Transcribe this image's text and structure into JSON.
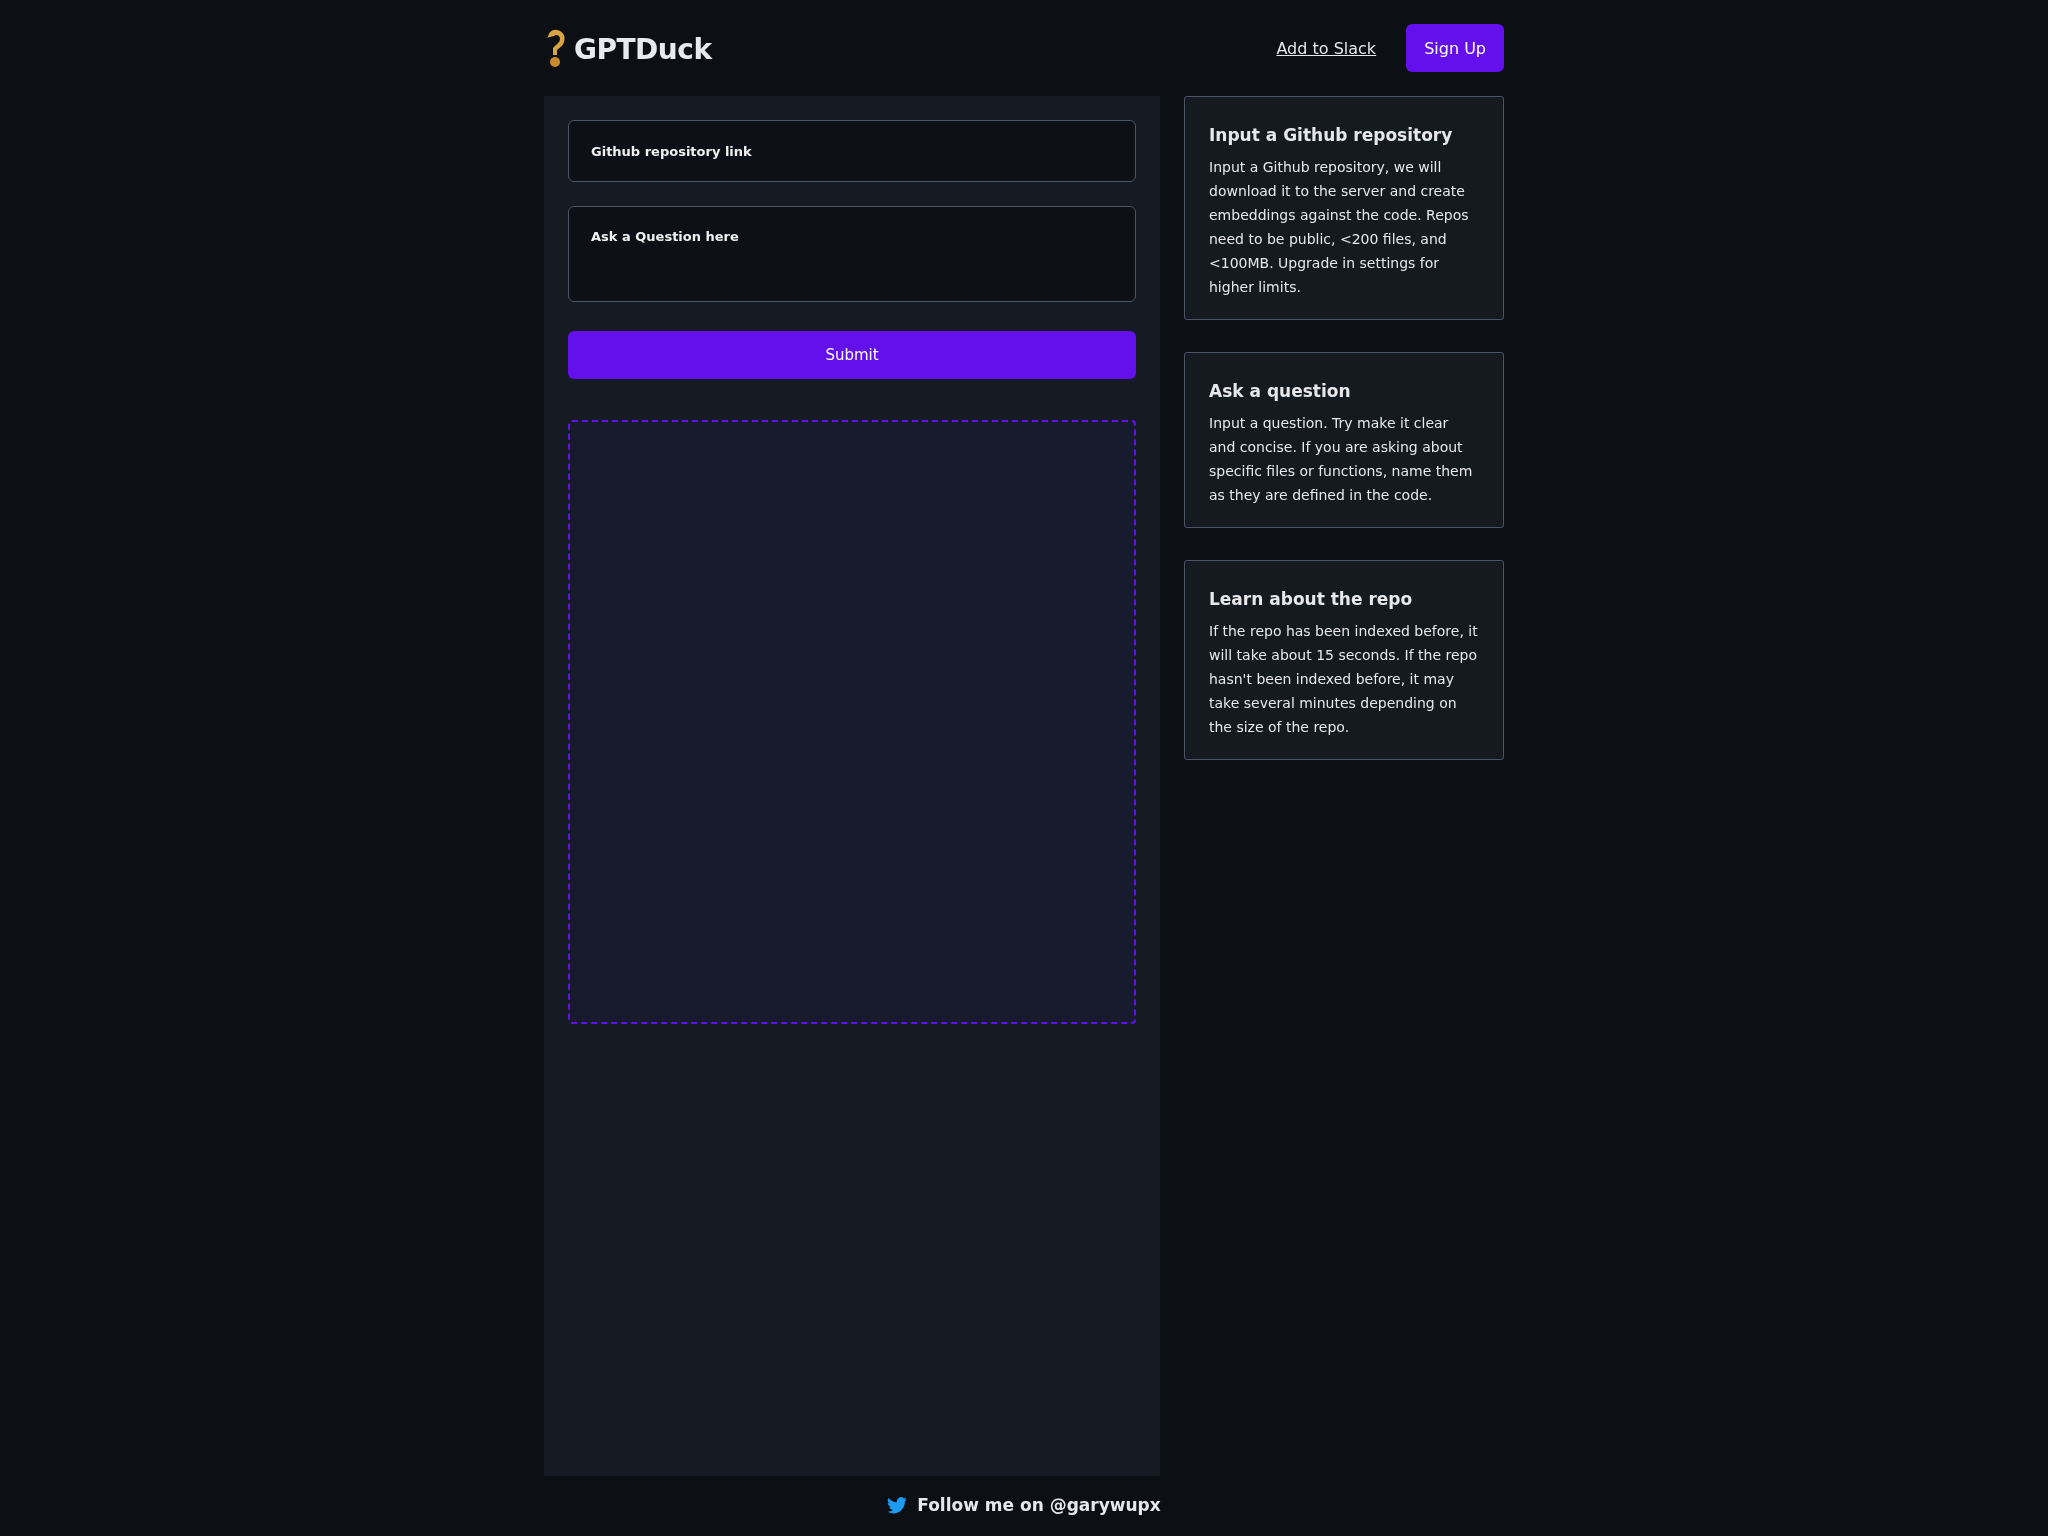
{
  "header": {
    "brand": "GPTDuck",
    "links": [
      {
        "label": "Add to Slack",
        "kind": "link"
      },
      {
        "label": "Sign Up",
        "kind": "button"
      }
    ]
  },
  "form": {
    "repo_field": {
      "placeholder": "Github repository link"
    },
    "question_field": {
      "placeholder": "Ask a Question here"
    },
    "submit": "Submit"
  },
  "info_cards": [
    {
      "title": "Input a Github repository",
      "body": "Input a Github repository, we will download it to the server and create embeddings against the code. Repos need to be public, <200 files, and <100MB. Upgrade in settings for higher limits."
    },
    {
      "title": "Ask a question",
      "body": "Input a question. Try make it clear and concise. If you are asking about specific files or functions, name them as they are defined in the code."
    },
    {
      "title": "Learn about the repo",
      "body": "If the repo has been indexed before, it will take about 15 seconds. If the repo hasn't been indexed before, it may take several minutes depending on the size of the repo."
    }
  ],
  "footer": {
    "text": "Follow me on @garywupx"
  }
}
